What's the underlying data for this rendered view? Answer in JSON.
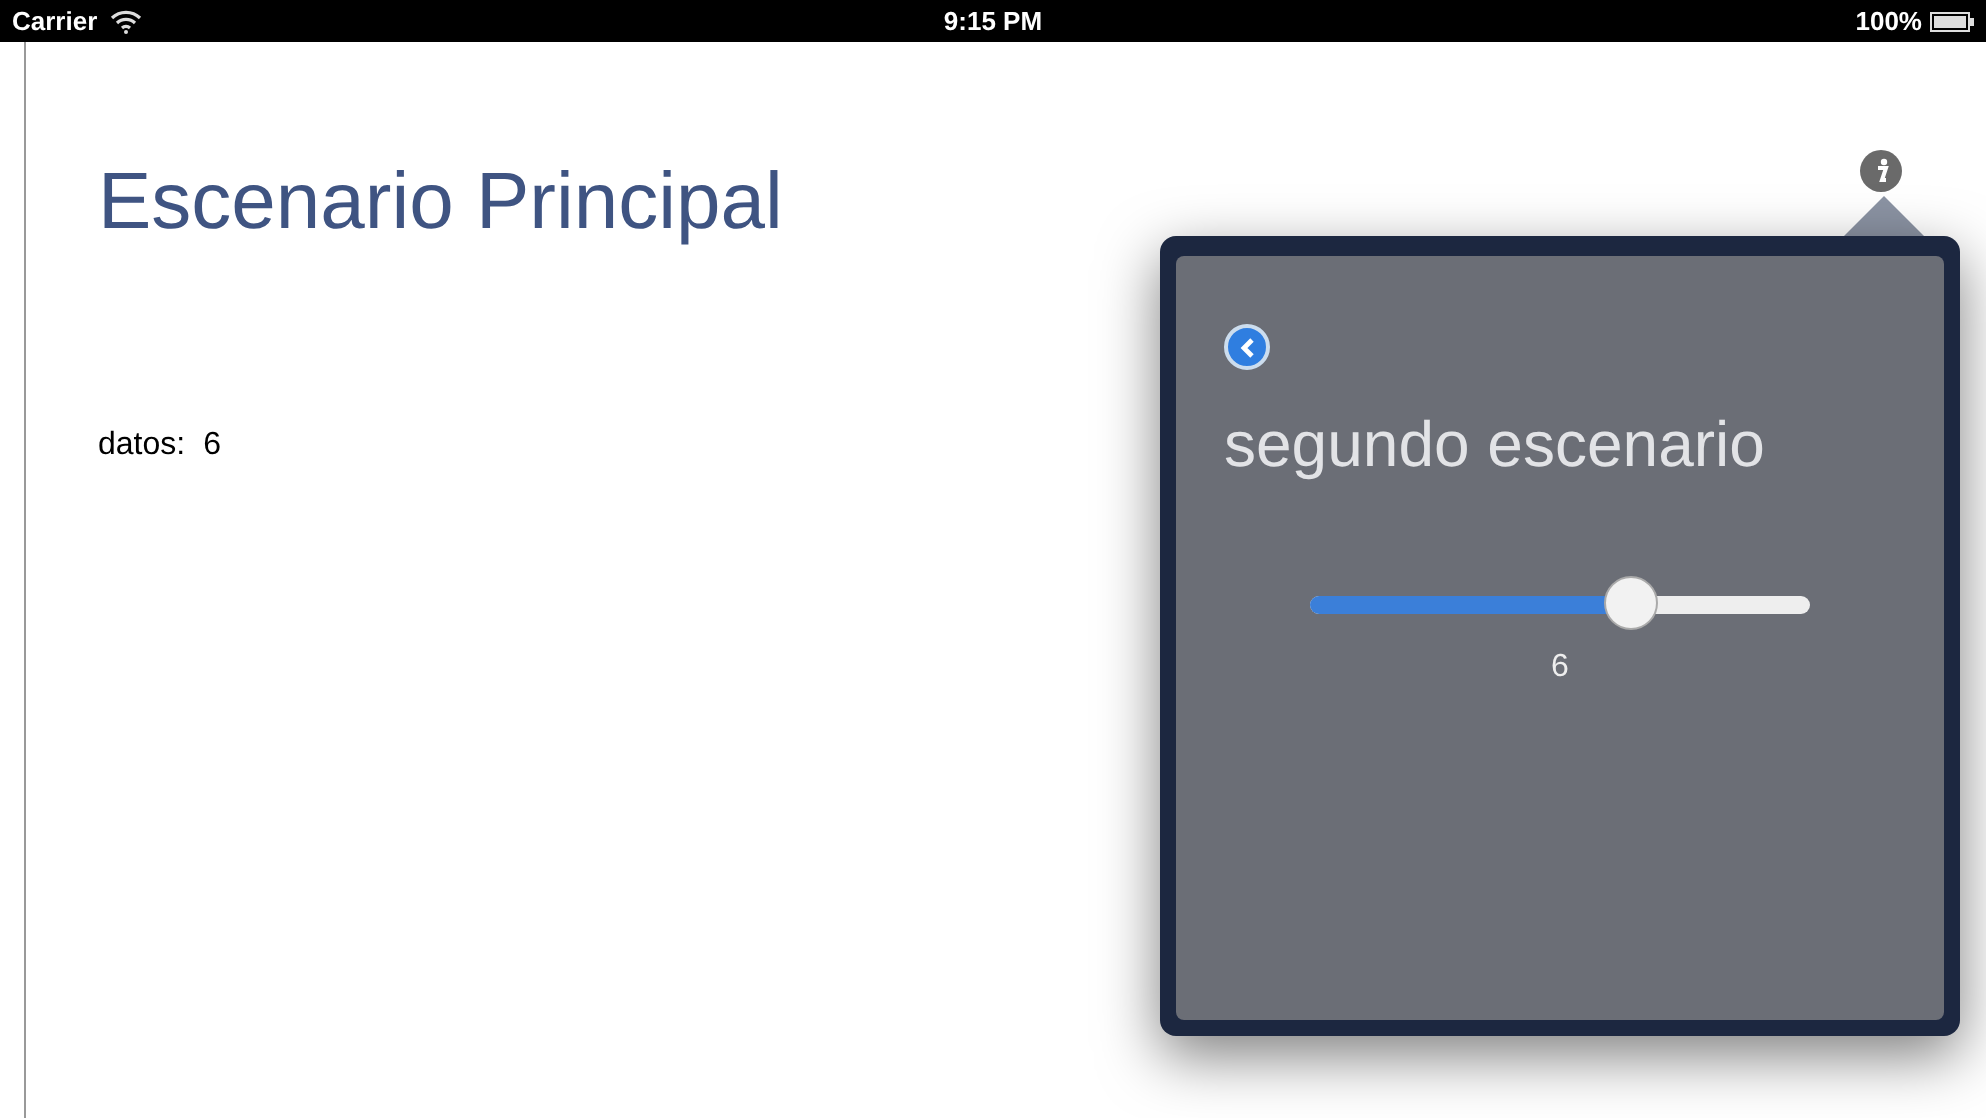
{
  "status_bar": {
    "carrier": "Carrier",
    "time": "9:15 PM",
    "battery": "100%"
  },
  "main": {
    "title": "Escenario Principal",
    "data_label": "datos:",
    "data_value": "6"
  },
  "popover": {
    "title": "segundo escenario",
    "slider": {
      "level": 0.64
    },
    "slider_value": "6"
  }
}
